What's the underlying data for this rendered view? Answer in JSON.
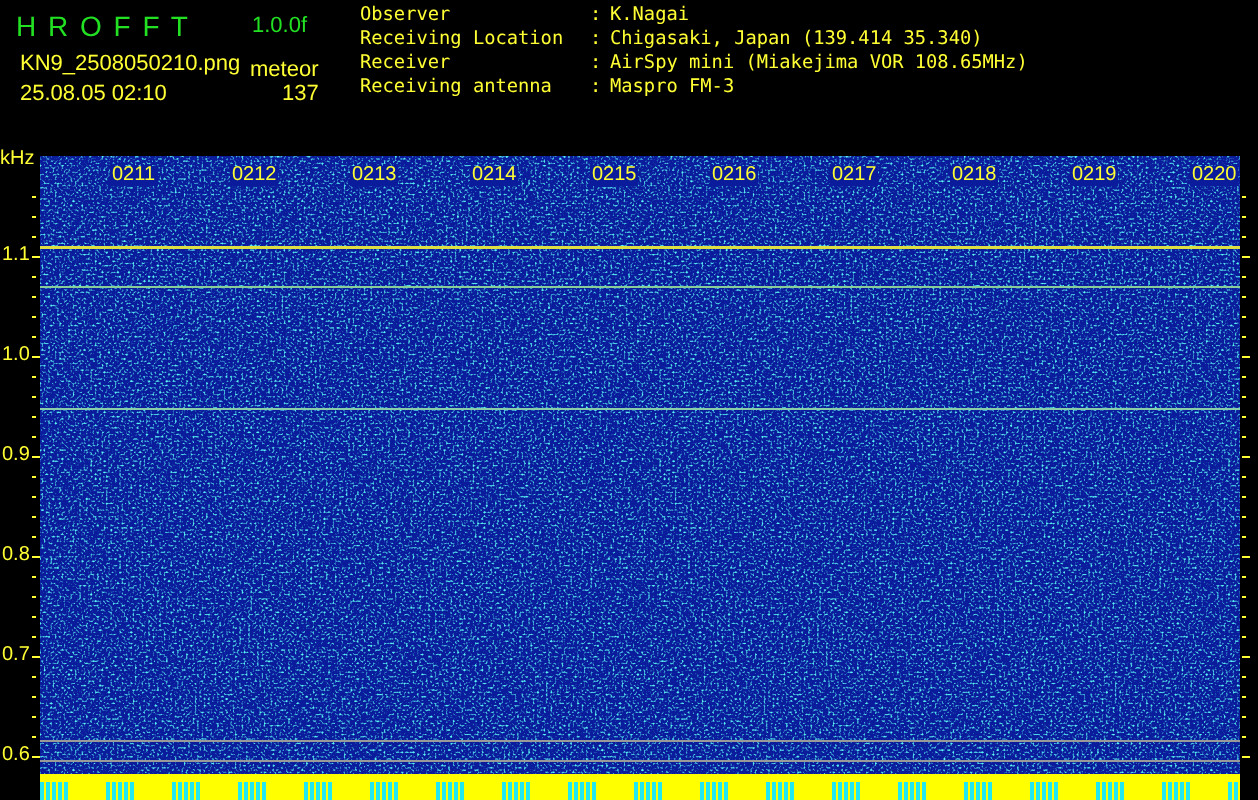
{
  "app": {
    "title": "H R O F F T",
    "version": "1.0.0f"
  },
  "file": {
    "filename": "KN9_2508050210.png",
    "timestamp": "25.08.05 02:10"
  },
  "meteor": {
    "label": "meteor",
    "count": "137"
  },
  "info": [
    {
      "label": "Observer",
      "separator": ":",
      "value": "K.Nagai"
    },
    {
      "label": "Receiving Location",
      "separator": ":",
      "value": "Chigasaki, Japan (139.414 35.340)"
    },
    {
      "label": "Receiver",
      "separator": ":",
      "value": "AirSpy mini (Miakejima VOR 108.65MHz)"
    },
    {
      "label": "Receiving antenna",
      "separator": ":",
      "value": "Maspro FM-3"
    }
  ],
  "spectrogram": {
    "unit": "kHz",
    "y_labels": [
      "1.1",
      "1.0",
      "0.9",
      "0.8",
      "0.7",
      "0.6"
    ],
    "time_labels": [
      "0211",
      "0212",
      "0213",
      "0214",
      "0215",
      "0216",
      "0217",
      "0218",
      "0219",
      "0220"
    ]
  }
}
